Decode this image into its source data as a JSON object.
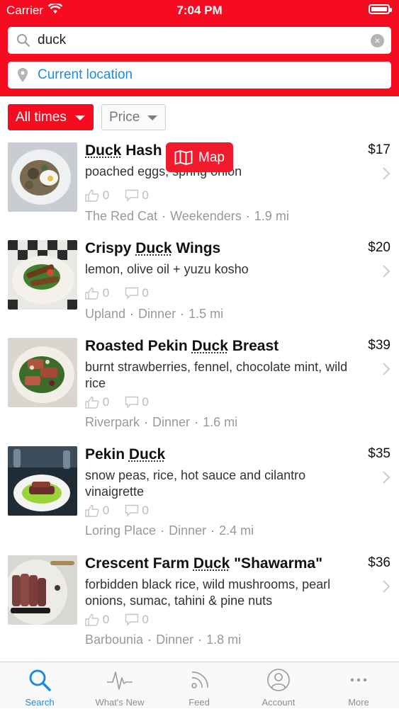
{
  "status_bar": {
    "carrier": "Carrier",
    "time": "7:04 PM"
  },
  "search": {
    "query": "duck",
    "location": "Current location"
  },
  "filters": {
    "times_label": "All times",
    "price_label": "Price"
  },
  "map_button": {
    "label": "Map"
  },
  "results": [
    {
      "title_pre": "",
      "title_hl": "Duck",
      "title_post": " Hash",
      "description": "poached eggs, spring onion",
      "price": "$17",
      "likes": "0",
      "comments": "0",
      "restaurant": "The Red Cat",
      "meal": "Weekenders",
      "distance": "1.9 mi"
    },
    {
      "title_pre": "Crispy ",
      "title_hl": "Duck",
      "title_post": " Wings",
      "description": "lemon, olive oil + yuzu kosho",
      "price": "$20",
      "likes": "0",
      "comments": "0",
      "restaurant": "Upland",
      "meal": "Dinner",
      "distance": "1.5 mi"
    },
    {
      "title_pre": "Roasted Pekin ",
      "title_hl": "Duck",
      "title_post": " Breast",
      "description": "burnt strawberries, fennel, chocolate mint, wild rice",
      "price": "$39",
      "likes": "0",
      "comments": "0",
      "restaurant": "Riverpark",
      "meal": "Dinner",
      "distance": "1.6 mi"
    },
    {
      "title_pre": "Pekin ",
      "title_hl": "Duck",
      "title_post": "",
      "description": "snow peas, rice, hot sauce and cilantro vinaigrette",
      "price": "$35",
      "likes": "0",
      "comments": "0",
      "restaurant": "Loring Place",
      "meal": "Dinner",
      "distance": "2.4 mi"
    },
    {
      "title_pre": "Crescent Farm ",
      "title_hl": "Duck",
      "title_post": " \"Shawarma\"",
      "description": "forbidden black rice, wild mushrooms, pearl onions, sumac, tahini & pine nuts",
      "price": "$36",
      "likes": "0",
      "comments": "0",
      "restaurant": "Barbounia",
      "meal": "Dinner",
      "distance": "1.8 mi"
    }
  ],
  "tabs": [
    {
      "label": "Search",
      "icon": "search-icon",
      "active": true
    },
    {
      "label": "What's New",
      "icon": "pulse-icon",
      "active": false
    },
    {
      "label": "Feed",
      "icon": "feed-icon",
      "active": false
    },
    {
      "label": "Account",
      "icon": "account-icon",
      "active": false
    },
    {
      "label": "More",
      "icon": "more-icon",
      "active": false
    }
  ],
  "colors": {
    "brand_red": "#f50c20",
    "link_blue": "#1c8be0"
  }
}
